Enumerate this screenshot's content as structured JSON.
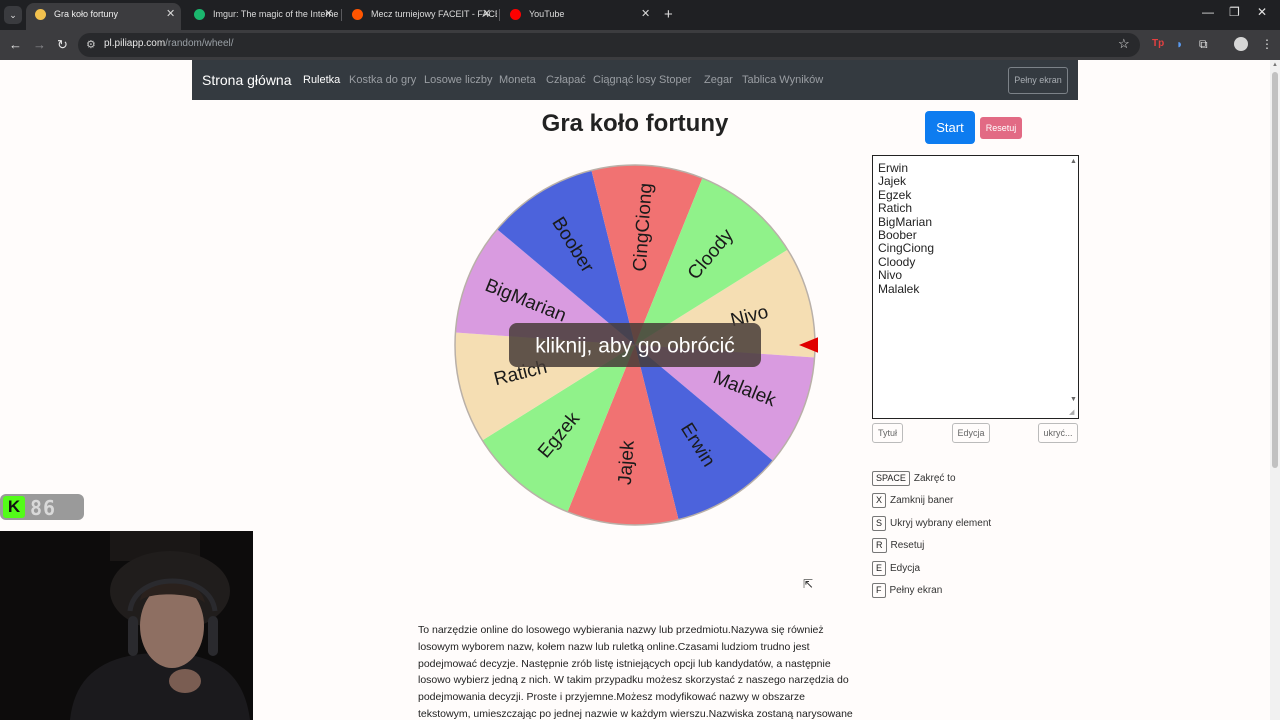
{
  "browser": {
    "tabs": [
      {
        "title": "Gra koło fortuny",
        "active": true,
        "favicon_color": "#f2c14e"
      },
      {
        "title": "Imgur: The magic of the Interne",
        "active": false,
        "favicon_color": "#1bb76e"
      },
      {
        "title": "Mecz turniejowy FACEIT - FACEI",
        "active": false,
        "favicon_color": "#ff5500"
      },
      {
        "title": "YouTube",
        "active": false,
        "favicon_color": "#ff0000"
      }
    ],
    "url_host": "pl.piliapp.com",
    "url_path": "/random/wheel/"
  },
  "navbar": {
    "brand": "Strona główna",
    "links": [
      "Ruletka",
      "Kostka do gry",
      "Losowe liczby",
      "Moneta",
      "Człapać",
      "Ciągnąć losy",
      "Stoper",
      "Zegar",
      "Tablica Wyników"
    ],
    "active_link": "Ruletka",
    "fullscreen_label": "Pełny ekran"
  },
  "title": "Gra koło fortuny",
  "controls": {
    "start_label": "Start",
    "reset_label": "Resetuj"
  },
  "wheel": {
    "overlay_text": "kliknij, aby go obrócić",
    "segments": [
      {
        "name": "Nivo",
        "color": "#f5deb3"
      },
      {
        "name": "Malalek",
        "color": "#d99be0"
      },
      {
        "name": "Erwin",
        "color": "#4c63dc"
      },
      {
        "name": "Jajek",
        "color": "#f17272"
      },
      {
        "name": "Egzek",
        "color": "#90f28a"
      },
      {
        "name": "Ratich",
        "color": "#f5deb3"
      },
      {
        "name": "BigMarian",
        "color": "#d99be0"
      },
      {
        "name": "Boober",
        "color": "#4c63dc"
      },
      {
        "name": "CingCiong",
        "color": "#f17272"
      },
      {
        "name": "Cloody",
        "color": "#90f28a"
      }
    ],
    "pointer_color": "#e00000"
  },
  "names_textarea": [
    "Erwin",
    "Jajek",
    "Egzek",
    "Ratich",
    "BigMarian",
    "Boober",
    "CingCiong",
    "Cloody",
    "Nivo",
    "Malalek"
  ],
  "textarea_buttons": {
    "title_label": "Tytuł",
    "edit_label": "Edycja",
    "hide_label": "ukryć..."
  },
  "shortcuts": [
    {
      "key": "SPACE",
      "label": "Zakręć to"
    },
    {
      "key": "X",
      "label": "Zamknij baner"
    },
    {
      "key": "S",
      "label": "Ukryj wybrany element"
    },
    {
      "key": "R",
      "label": "Resetuj"
    },
    {
      "key": "E",
      "label": "Edycja"
    },
    {
      "key": "F",
      "label": "Pełny ekran"
    }
  ],
  "description": "To narzędzie online do losowego wybierania nazwy lub przedmiotu.Nazywa się również losowym wyborem nazw, kołem nazw lub ruletką online.Czasami ludziom trudno jest podejmować decyzje. Następnie zrób listę istniejących opcji lub kandydatów, a następnie losowo wybierz jedną z nich. W takim przypadku możesz skorzystać z naszego narzędzia do podejmowania decyzji. Proste i przyjemne.Możesz modyfikować nazwy w obszarze tekstowym, umieszczając po jednej nazwie w każdym wierszu.Nazwiska zostaną narysowane",
  "overlay_badge": {
    "logo": "K",
    "count": "86",
    "logo_color": "#53fc18"
  }
}
